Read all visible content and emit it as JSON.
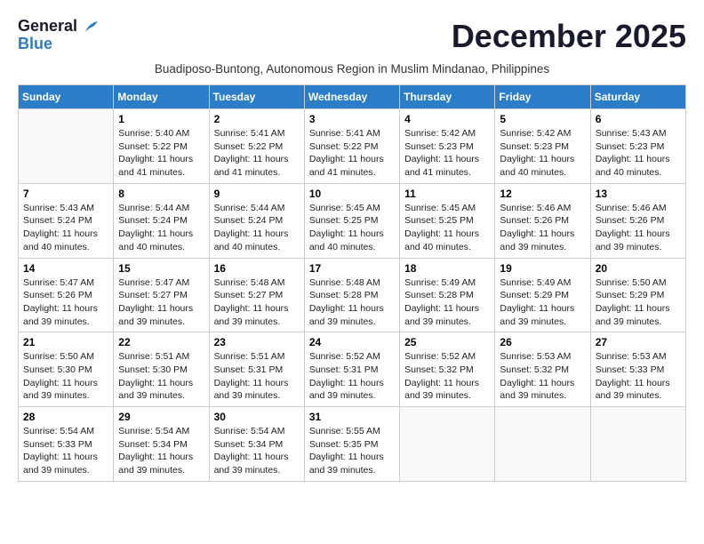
{
  "header": {
    "logo_line1": "General",
    "logo_line2": "Blue",
    "month_year": "December 2025",
    "location": "Buadiposo-Buntong, Autonomous Region in Muslim Mindanao, Philippines"
  },
  "days_of_week": [
    "Sunday",
    "Monday",
    "Tuesday",
    "Wednesday",
    "Thursday",
    "Friday",
    "Saturday"
  ],
  "weeks": [
    [
      {
        "day": "",
        "sunrise": "",
        "sunset": "",
        "daylight": ""
      },
      {
        "day": "1",
        "sunrise": "Sunrise: 5:40 AM",
        "sunset": "Sunset: 5:22 PM",
        "daylight": "Daylight: 11 hours and 41 minutes."
      },
      {
        "day": "2",
        "sunrise": "Sunrise: 5:41 AM",
        "sunset": "Sunset: 5:22 PM",
        "daylight": "Daylight: 11 hours and 41 minutes."
      },
      {
        "day": "3",
        "sunrise": "Sunrise: 5:41 AM",
        "sunset": "Sunset: 5:22 PM",
        "daylight": "Daylight: 11 hours and 41 minutes."
      },
      {
        "day": "4",
        "sunrise": "Sunrise: 5:42 AM",
        "sunset": "Sunset: 5:23 PM",
        "daylight": "Daylight: 11 hours and 41 minutes."
      },
      {
        "day": "5",
        "sunrise": "Sunrise: 5:42 AM",
        "sunset": "Sunset: 5:23 PM",
        "daylight": "Daylight: 11 hours and 40 minutes."
      },
      {
        "day": "6",
        "sunrise": "Sunrise: 5:43 AM",
        "sunset": "Sunset: 5:23 PM",
        "daylight": "Daylight: 11 hours and 40 minutes."
      }
    ],
    [
      {
        "day": "7",
        "sunrise": "Sunrise: 5:43 AM",
        "sunset": "Sunset: 5:24 PM",
        "daylight": "Daylight: 11 hours and 40 minutes."
      },
      {
        "day": "8",
        "sunrise": "Sunrise: 5:44 AM",
        "sunset": "Sunset: 5:24 PM",
        "daylight": "Daylight: 11 hours and 40 minutes."
      },
      {
        "day": "9",
        "sunrise": "Sunrise: 5:44 AM",
        "sunset": "Sunset: 5:24 PM",
        "daylight": "Daylight: 11 hours and 40 minutes."
      },
      {
        "day": "10",
        "sunrise": "Sunrise: 5:45 AM",
        "sunset": "Sunset: 5:25 PM",
        "daylight": "Daylight: 11 hours and 40 minutes."
      },
      {
        "day": "11",
        "sunrise": "Sunrise: 5:45 AM",
        "sunset": "Sunset: 5:25 PM",
        "daylight": "Daylight: 11 hours and 40 minutes."
      },
      {
        "day": "12",
        "sunrise": "Sunrise: 5:46 AM",
        "sunset": "Sunset: 5:26 PM",
        "daylight": "Daylight: 11 hours and 39 minutes."
      },
      {
        "day": "13",
        "sunrise": "Sunrise: 5:46 AM",
        "sunset": "Sunset: 5:26 PM",
        "daylight": "Daylight: 11 hours and 39 minutes."
      }
    ],
    [
      {
        "day": "14",
        "sunrise": "Sunrise: 5:47 AM",
        "sunset": "Sunset: 5:26 PM",
        "daylight": "Daylight: 11 hours and 39 minutes."
      },
      {
        "day": "15",
        "sunrise": "Sunrise: 5:47 AM",
        "sunset": "Sunset: 5:27 PM",
        "daylight": "Daylight: 11 hours and 39 minutes."
      },
      {
        "day": "16",
        "sunrise": "Sunrise: 5:48 AM",
        "sunset": "Sunset: 5:27 PM",
        "daylight": "Daylight: 11 hours and 39 minutes."
      },
      {
        "day": "17",
        "sunrise": "Sunrise: 5:48 AM",
        "sunset": "Sunset: 5:28 PM",
        "daylight": "Daylight: 11 hours and 39 minutes."
      },
      {
        "day": "18",
        "sunrise": "Sunrise: 5:49 AM",
        "sunset": "Sunset: 5:28 PM",
        "daylight": "Daylight: 11 hours and 39 minutes."
      },
      {
        "day": "19",
        "sunrise": "Sunrise: 5:49 AM",
        "sunset": "Sunset: 5:29 PM",
        "daylight": "Daylight: 11 hours and 39 minutes."
      },
      {
        "day": "20",
        "sunrise": "Sunrise: 5:50 AM",
        "sunset": "Sunset: 5:29 PM",
        "daylight": "Daylight: 11 hours and 39 minutes."
      }
    ],
    [
      {
        "day": "21",
        "sunrise": "Sunrise: 5:50 AM",
        "sunset": "Sunset: 5:30 PM",
        "daylight": "Daylight: 11 hours and 39 minutes."
      },
      {
        "day": "22",
        "sunrise": "Sunrise: 5:51 AM",
        "sunset": "Sunset: 5:30 PM",
        "daylight": "Daylight: 11 hours and 39 minutes."
      },
      {
        "day": "23",
        "sunrise": "Sunrise: 5:51 AM",
        "sunset": "Sunset: 5:31 PM",
        "daylight": "Daylight: 11 hours and 39 minutes."
      },
      {
        "day": "24",
        "sunrise": "Sunrise: 5:52 AM",
        "sunset": "Sunset: 5:31 PM",
        "daylight": "Daylight: 11 hours and 39 minutes."
      },
      {
        "day": "25",
        "sunrise": "Sunrise: 5:52 AM",
        "sunset": "Sunset: 5:32 PM",
        "daylight": "Daylight: 11 hours and 39 minutes."
      },
      {
        "day": "26",
        "sunrise": "Sunrise: 5:53 AM",
        "sunset": "Sunset: 5:32 PM",
        "daylight": "Daylight: 11 hours and 39 minutes."
      },
      {
        "day": "27",
        "sunrise": "Sunrise: 5:53 AM",
        "sunset": "Sunset: 5:33 PM",
        "daylight": "Daylight: 11 hours and 39 minutes."
      }
    ],
    [
      {
        "day": "28",
        "sunrise": "Sunrise: 5:54 AM",
        "sunset": "Sunset: 5:33 PM",
        "daylight": "Daylight: 11 hours and 39 minutes."
      },
      {
        "day": "29",
        "sunrise": "Sunrise: 5:54 AM",
        "sunset": "Sunset: 5:34 PM",
        "daylight": "Daylight: 11 hours and 39 minutes."
      },
      {
        "day": "30",
        "sunrise": "Sunrise: 5:54 AM",
        "sunset": "Sunset: 5:34 PM",
        "daylight": "Daylight: 11 hours and 39 minutes."
      },
      {
        "day": "31",
        "sunrise": "Sunrise: 5:55 AM",
        "sunset": "Sunset: 5:35 PM",
        "daylight": "Daylight: 11 hours and 39 minutes."
      },
      {
        "day": "",
        "sunrise": "",
        "sunset": "",
        "daylight": ""
      },
      {
        "day": "",
        "sunrise": "",
        "sunset": "",
        "daylight": ""
      },
      {
        "day": "",
        "sunrise": "",
        "sunset": "",
        "daylight": ""
      }
    ]
  ]
}
